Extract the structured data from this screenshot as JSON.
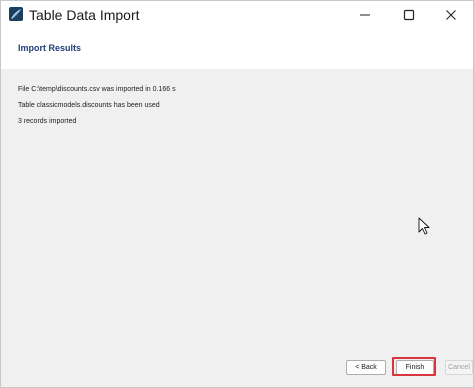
{
  "window": {
    "title": "Table Data Import",
    "icon": "mysql-workbench-icon",
    "controls": {
      "minimize_icon": "minimize-icon",
      "maximize_icon": "maximize-icon",
      "close_icon": "close-icon"
    }
  },
  "header": {
    "title": "Import Results"
  },
  "results": {
    "messages": [
      "File C:\\temp\\discounts.csv was imported in 0.166 s",
      "Table classicmodels.discounts has been used",
      "3 records imported"
    ]
  },
  "buttons": {
    "back_label": "< Back",
    "finish_label": "Finish",
    "cancel_label": "Cancel"
  },
  "colors": {
    "header_title": "#1f3e7a",
    "highlight": "#d9363e"
  }
}
